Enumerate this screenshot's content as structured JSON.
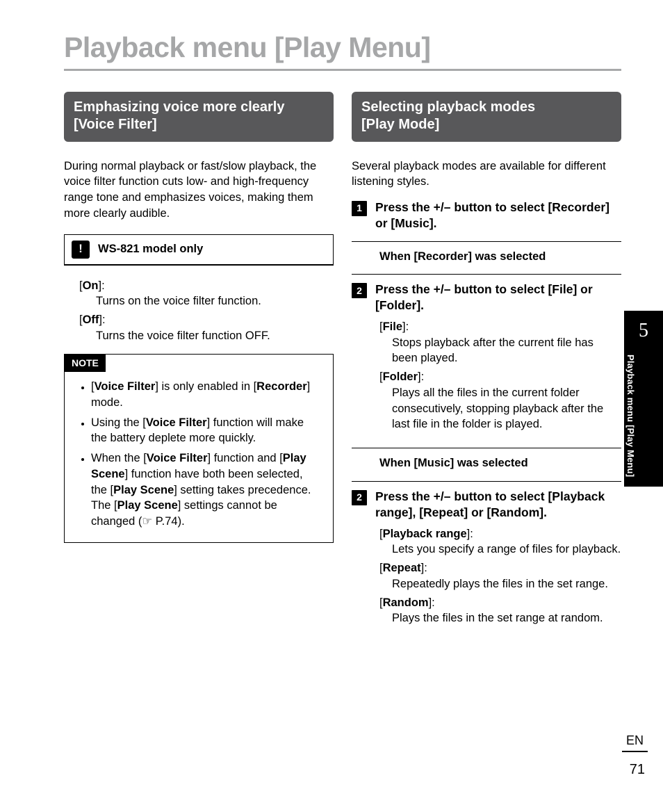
{
  "chapter_number": "5",
  "page_title": "Playback menu [Play Menu]",
  "side_label": "Playback menu [Play Menu]",
  "lang": "EN",
  "page_number": "71",
  "left": {
    "section_line1": "Emphasizing voice more clearly",
    "section_line2": "[Voice Filter]",
    "intro": "During normal playback or fast/slow playback, the voice filter function cuts low- and high-frequency range tone and emphasizes voices, making them more clearly audible.",
    "callout": {
      "badge": "!",
      "title": "WS-821 model only"
    },
    "options": [
      {
        "label": "On",
        "desc": "Turns on the voice filter function."
      },
      {
        "label": "Off",
        "desc": "Turns the voice filter function OFF."
      }
    ],
    "note_title": "NOTE",
    "notes": {
      "n1a": "[",
      "n1b": "Voice Filter",
      "n1c": "] is only enabled in [",
      "n1d": "Recorder",
      "n1e": "] mode.",
      "n2a": "Using the [",
      "n2b": "Voice Filter",
      "n2c": "] function will make the battery deplete more quickly.",
      "n3a": "When the [",
      "n3b": "Voice Filter",
      "n3c": "] function and [",
      "n3d": "Play Scene",
      "n3e": "] function have both been selected, the [",
      "n3f": "Play Scene",
      "n3g": "] setting takes precedence. The [",
      "n3h": "Play Scene",
      "n3i": "] settings cannot be changed (☞ P.74)."
    }
  },
  "right": {
    "section_line1": "Selecting playback modes",
    "section_line2": "[Play Mode]",
    "intro": "Several playback modes are available for different listening styles.",
    "step1_a": "Press the +/– button to select [",
    "step1_b": "Recorder",
    "step1_c": "] or [",
    "step1_d": "Music",
    "step1_e": "].",
    "when_recorder_a": "When [",
    "when_recorder_b": "Recorder",
    "when_recorder_c": "] was selected",
    "step2a_a": "Press the +/– button to select [",
    "step2a_b": "File",
    "step2a_c": "] or [",
    "step2a_d": "Folder",
    "step2a_e": "].",
    "rec_opts": [
      {
        "label": "File",
        "desc": "Stops playback after the current file has been played."
      },
      {
        "label": "Folder",
        "desc": "Plays all the files in the current folder consecutively, stopping playback after the last file in the folder is played."
      }
    ],
    "when_music_a": "When [",
    "when_music_b": "Music",
    "when_music_c": "] was selected",
    "step2b_a": "Press the +/– button to select [",
    "step2b_b": "Playback range",
    "step2b_c": "], [",
    "step2b_d": "Repeat",
    "step2b_e": "] or [",
    "step2b_f": "Random",
    "step2b_g": "].",
    "music_opts": [
      {
        "label": "Playback range",
        "desc": "Lets you specify a range of files for playback."
      },
      {
        "label": "Repeat",
        "desc": "Repeatedly plays the files in the set range."
      },
      {
        "label": "Random",
        "desc": "Plays the files in the set range at random."
      }
    ]
  }
}
